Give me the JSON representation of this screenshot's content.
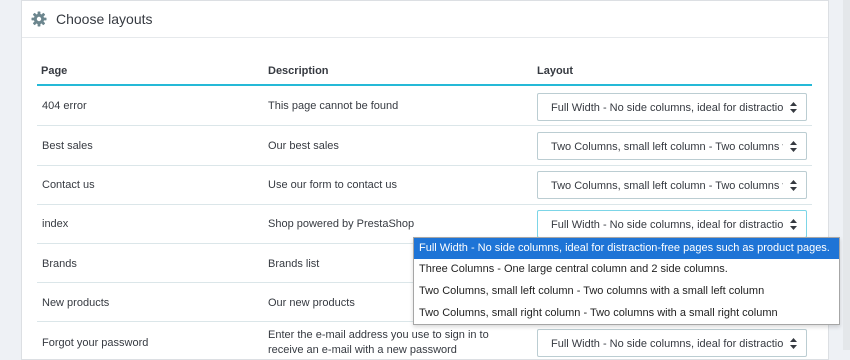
{
  "panel": {
    "title": "Choose layouts",
    "icon": "gear-icon"
  },
  "table": {
    "headers": {
      "page": "Page",
      "description": "Description",
      "layout": "Layout"
    },
    "rows": [
      {
        "page": "404 error",
        "description": "This page cannot be found",
        "layout": "Full Width - No side columns, ideal for distraction-free pages such as product pages."
      },
      {
        "page": "Best sales",
        "description": "Our best sales",
        "layout": "Two Columns, small left column - Two columns with a small left column"
      },
      {
        "page": "Contact us",
        "description": "Use our form to contact us",
        "layout": "Two Columns, small left column - Two columns with a small left column"
      },
      {
        "page": "index",
        "description": "Shop powered by PrestaShop",
        "layout": "Full Width - No side columns, ideal for distraction-free pages such as product pages."
      },
      {
        "page": "Brands",
        "description": "Brands list",
        "layout": ""
      },
      {
        "page": "New products",
        "description": "Our new products",
        "layout": ""
      },
      {
        "page": "Forgot your password",
        "description": "Enter the e-mail address you use to sign in to receive an e-mail with a new password",
        "layout": "Full Width - No side columns, ideal for distraction-free pages such as product pages."
      }
    ]
  },
  "dropdown": {
    "open_for_row": "index",
    "options": [
      {
        "label": "Full Width - No side columns, ideal for distraction-free pages such as product pages.",
        "selected": true
      },
      {
        "label": "Three Columns - One large central column and 2 side columns.",
        "selected": false
      },
      {
        "label": "Two Columns, small left column - Two columns with a small left column",
        "selected": false
      },
      {
        "label": "Two Columns, small right column - Two columns with a small right column",
        "selected": false
      }
    ]
  },
  "colors": {
    "accent": "#25b9d7",
    "selected_option": "#1e74d6"
  }
}
